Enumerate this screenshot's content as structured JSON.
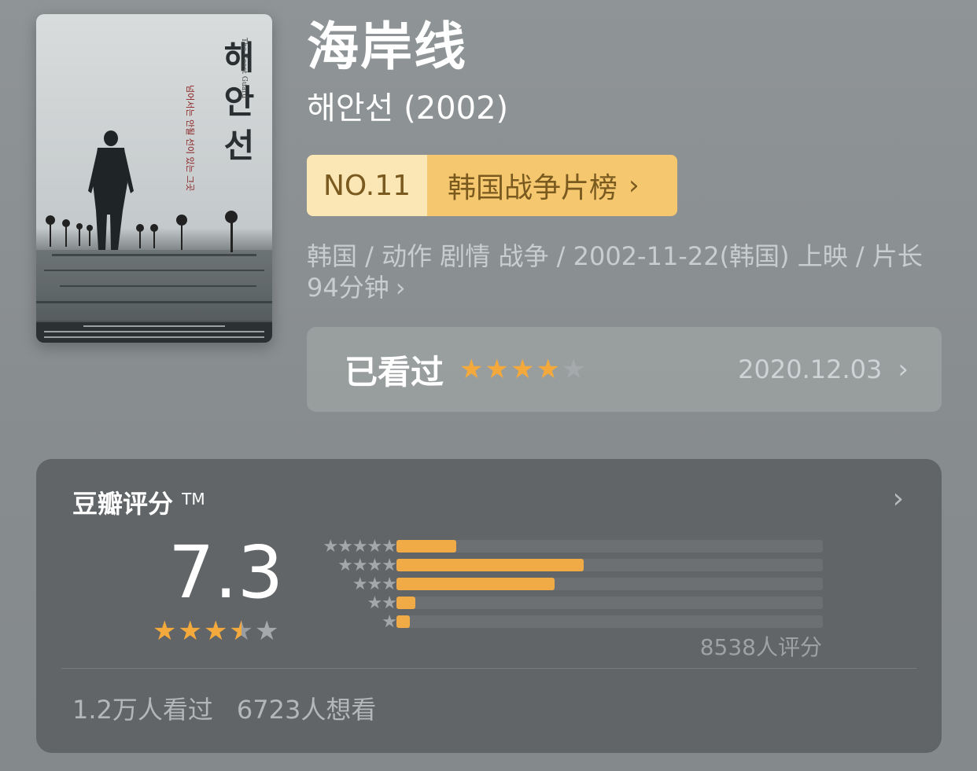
{
  "movie": {
    "title": "海岸线",
    "subtitle": "해안선 (2002)",
    "poster": {
      "title_text": "해안선",
      "english_text": "The Coast Guard",
      "tagline_text": "넘어서는 안될 선이 있는 그곳"
    }
  },
  "rank": {
    "number": "NO.11",
    "list_name": "韩国战争片榜",
    "chevron_icon": "chevron-right-icon"
  },
  "meta": {
    "text": "韩国 / 动作 剧情 战争 / 2002-11-22(韩国) 上映 / 片长 94分钟",
    "chevron": "›"
  },
  "watched": {
    "label": "已看过",
    "user_rating_stars": 4,
    "date": "2020.12.03",
    "chevron": "›"
  },
  "rating": {
    "title": "豆瓣评分",
    "trademark": "TM",
    "score": "7.3",
    "score_stars": 3.5,
    "distribution": [
      {
        "stars": 5,
        "fraction": 0.14
      },
      {
        "stars": 4,
        "fraction": 0.44
      },
      {
        "stars": 3,
        "fraction": 0.37
      },
      {
        "stars": 2,
        "fraction": 0.045
      },
      {
        "stars": 1,
        "fraction": 0.032
      }
    ],
    "votes": "8538人评分",
    "chevron": "›"
  },
  "stats": {
    "watched": "1.2万人看过",
    "want": "6723人想看"
  },
  "colors": {
    "accent": "#f4a93d",
    "rank_light": "#fbe7b6",
    "rank_dark": "#f5c870",
    "panel": "#616567"
  }
}
